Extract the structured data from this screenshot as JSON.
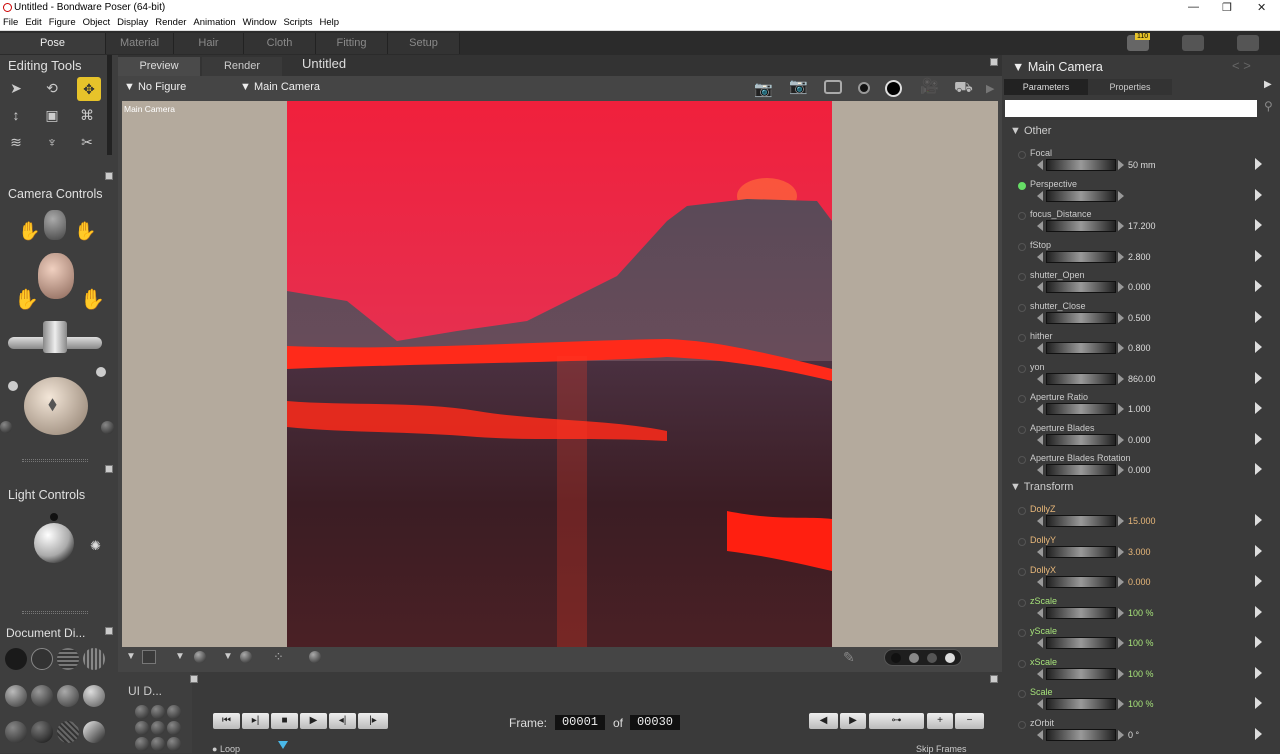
{
  "window": {
    "title": "Untitled - Bondware Poser (64-bit)",
    "controls": [
      "—",
      "❐",
      "✕"
    ]
  },
  "menu": [
    "File",
    "Edit",
    "Figure",
    "Object",
    "Display",
    "Render",
    "Animation",
    "Window",
    "Scripts",
    "Help"
  ],
  "rooms": [
    "Pose",
    "Material",
    "Hair",
    "Cloth",
    "Fitting",
    "Setup"
  ],
  "notifications": {
    "badge": "110"
  },
  "left": {
    "editing_title": "Editing Tools",
    "camera_title": "Camera Controls",
    "light_title": "Light Controls",
    "doc_title": "Document Di..."
  },
  "document": {
    "tabs": [
      "Preview",
      "Render"
    ],
    "title": "Untitled",
    "figure_select": "No Figure",
    "camera_select": "Main Camera",
    "viewport_label": "Main Camera"
  },
  "bottom": {
    "ui_title": "UI D...",
    "frame_label": "Frame:",
    "frame_current": "00001",
    "frame_of": "of",
    "frame_total": "00030",
    "loop_label": "Loop",
    "skip_label": "Skip Frames"
  },
  "params": {
    "title": "Main Camera",
    "tabs": [
      "Parameters",
      "Properties"
    ],
    "search_placeholder": "",
    "group_other": "Other",
    "group_transform": "Transform",
    "other": [
      {
        "name": "Focal",
        "value": "50 mm"
      },
      {
        "name": "Perspective",
        "value": ""
      },
      {
        "name": "focus_Distance",
        "value": "17.200"
      },
      {
        "name": "fStop",
        "value": "2.800"
      },
      {
        "name": "shutter_Open",
        "value": "0.000"
      },
      {
        "name": "shutter_Close",
        "value": "0.500"
      },
      {
        "name": "hither",
        "value": "0.800"
      },
      {
        "name": "yon",
        "value": "860.00"
      },
      {
        "name": "Aperture Ratio",
        "value": "1.000"
      },
      {
        "name": "Aperture Blades",
        "value": "0.000"
      },
      {
        "name": "Aperture Blades Rotation",
        "value": "0.000"
      }
    ],
    "transform": [
      {
        "name": "DollyZ",
        "value": "15.000"
      },
      {
        "name": "DollyY",
        "value": "3.000"
      },
      {
        "name": "DollyX",
        "value": "0.000"
      },
      {
        "name": "zScale",
        "value": "100 %"
      },
      {
        "name": "yScale",
        "value": "100 %"
      },
      {
        "name": "xScale",
        "value": "100 %"
      },
      {
        "name": "Scale",
        "value": "100 %"
      },
      {
        "name": "zOrbit",
        "value": "0 °"
      }
    ]
  },
  "colors": {
    "accent": "#e7c32a",
    "dolly": "#e9b87a",
    "scale": "#a6e27a",
    "lava": "#ff2a1a"
  }
}
